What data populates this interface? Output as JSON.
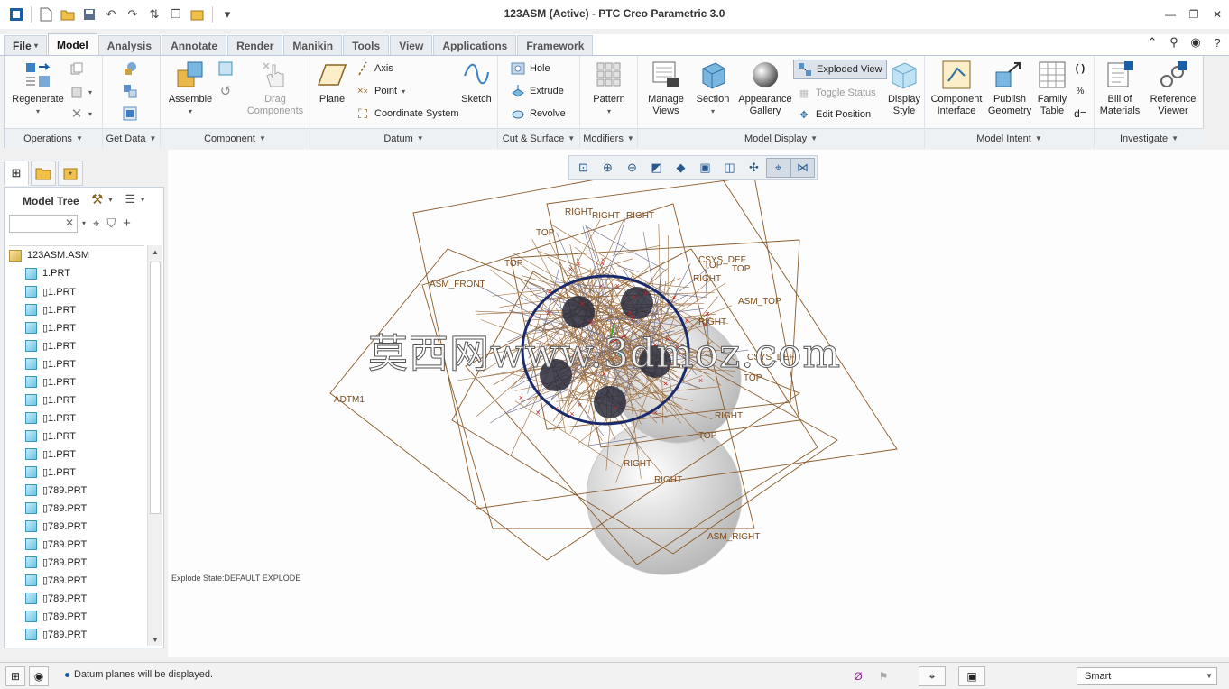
{
  "window": {
    "title": "123ASM (Active) - PTC Creo Parametric 3.0"
  },
  "tabs": [
    "File",
    "Model",
    "Analysis",
    "Annotate",
    "Render",
    "Manikin",
    "Tools",
    "View",
    "Applications",
    "Framework"
  ],
  "active_tab": "Model",
  "ribbon": {
    "operations": {
      "regenerate": "Regenerate",
      "footer": "Operations"
    },
    "get_data": {
      "footer": "Get Data"
    },
    "component": {
      "assemble": "Assemble",
      "drag": "Drag\nComponents",
      "footer": "Component"
    },
    "datum": {
      "plane": "Plane",
      "axis": "Axis",
      "point": "Point",
      "csys": "Coordinate System",
      "sketch": "Sketch",
      "footer": "Datum"
    },
    "cut_surface": {
      "hole": "Hole",
      "extrude": "Extrude",
      "revolve": "Revolve",
      "footer": "Cut & Surface"
    },
    "modifiers": {
      "pattern": "Pattern",
      "footer": "Modifiers"
    },
    "model_display": {
      "manage_views": "Manage\nViews",
      "section": "Section",
      "appearance_gallery": "Appearance\nGallery",
      "exploded_view": "Exploded View",
      "toggle_status": "Toggle Status",
      "edit_position": "Edit Position",
      "display_style": "Display\nStyle",
      "footer": "Model Display"
    },
    "model_intent": {
      "component_interface": "Component\nInterface",
      "publish_geometry": "Publish\nGeometry",
      "family_table": "Family\nTable",
      "footer": "Model Intent"
    },
    "investigate": {
      "bom": "Bill of\nMaterials",
      "reference_viewer": "Reference\nViewer",
      "footer": "Investigate"
    }
  },
  "model_tree": {
    "title": "Model Tree",
    "root": "123ASM.ASM",
    "items": [
      "1.PRT",
      "1.PRT",
      "1.PRT",
      "1.PRT",
      "1.PRT",
      "1.PRT",
      "1.PRT",
      "1.PRT",
      "1.PRT",
      "1.PRT",
      "1.PRT",
      "1.PRT",
      "789.PRT",
      "789.PRT",
      "789.PRT",
      "789.PRT",
      "789.PRT",
      "789.PRT",
      "789.PRT",
      "789.PRT",
      "789.PRT"
    ]
  },
  "graphics": {
    "explode_state": "Explode State:DEFAULT EXPLODE",
    "watermark": "莫西网www.3dmoz.com",
    "datum_labels": [
      "RIGHT",
      "RIGHT",
      "TOP",
      "RIGHT",
      "TOP",
      "ASM_FRONT",
      "ASM_TOP",
      "CSYS_DEF",
      "TOP",
      "RIGHT",
      "TOP",
      "ADTM1",
      "RIGHT",
      "TOP",
      "RIGHT",
      "RIGHT",
      "ASM_RIGHT",
      "CSYS_DEF",
      "RIGHT",
      "TOP"
    ]
  },
  "status_bar": {
    "message": "Datum planes will be displayed.",
    "filter": "Smart"
  }
}
